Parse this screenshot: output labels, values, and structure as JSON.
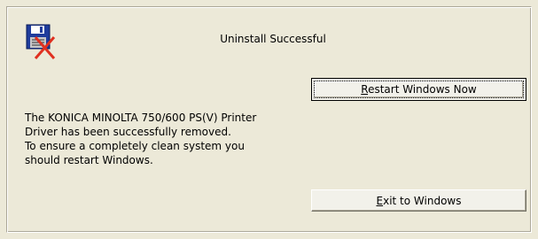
{
  "dialog": {
    "title": "Uninstall Successful",
    "icon": "floppy-disk-x-icon",
    "message": "The KONICA MINOLTA 750/600 PS(V) Printer\nDriver has been successfully removed.\nTo ensure a completely clean system you\nshould restart Windows.",
    "restart_button": {
      "mnemonic": "R",
      "rest": "estart Windows Now"
    },
    "exit_button": {
      "mnemonic": "E",
      "rest": "xit to Windows"
    }
  },
  "colors": {
    "background": "#ece9d8",
    "button_face": "#f2f1ea",
    "x_mark": "#e03020",
    "disk": "#1f3c9c"
  }
}
